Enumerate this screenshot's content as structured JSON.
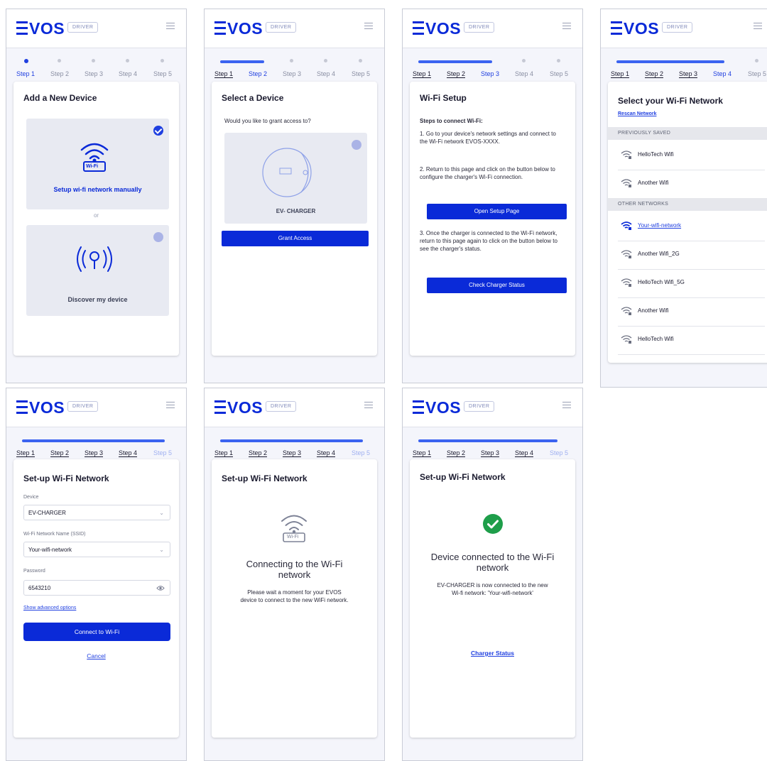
{
  "app": {
    "logo": "VOS",
    "badge": "DRIVER"
  },
  "steps": [
    "Step 1",
    "Step 2",
    "Step 3",
    "Step 4",
    "Step 5"
  ],
  "screen1": {
    "title": "Add a New Device",
    "option1": "Setup wi-fi network manually",
    "or": "or",
    "option2": "Discover my device",
    "wifi_badge": "Wi-Fi"
  },
  "screen2": {
    "title": "Select a Device",
    "question": "Would you like to grant access to?",
    "device_name": "EV- CHARGER",
    "button": "Grant Access"
  },
  "screen3": {
    "title": "Wi-Fi Setup",
    "subtitle": "Steps to connect Wi-Fi:",
    "step1": "1. Go to your device's network settings and connect to the Wi-Fi network EVOS-XXXX.",
    "step2": "2. Return to this page and click on the button below to configure the charger's Wi-Fi connection.",
    "button1": "Open Setup Page",
    "step3": "3. Once the charger is connected to the Wi-Fi network, return to this page again to click on the button below to see the charger's status.",
    "button2": "Check Charger Status"
  },
  "screen4": {
    "title": "Select your Wi-Fi Network",
    "rescan": "Rescan Network",
    "saved_header": "PREVIOUSLY SAVED",
    "saved": [
      "HelloTech Wifi",
      "Another Wifi"
    ],
    "other_header": "OTHER NETWORKS",
    "selected": "Your-wifi-network",
    "other": [
      "Another Wifi_2G",
      "HelloTech Wifi_5G",
      "Another Wifi",
      "HelloTech Wifi"
    ]
  },
  "screen5": {
    "title": "Set-up Wi-Fi Network",
    "device_label": "Device",
    "device_value": "EV-CHARGER",
    "ssid_label": "Wi-Fi Network Name (SSID)",
    "ssid_value": "Your-wifi-network",
    "password_label": "Password",
    "password_value": "6543210",
    "advanced": "Show advanced options",
    "button": "Connect to Wi-Fi",
    "cancel": "Cancel"
  },
  "screen6": {
    "title": "Set-up Wi-Fi Network",
    "heading": "Connecting to the Wi-Fi network",
    "message": "Please wait a moment for your EVOS device to connect to the new WiFi network.",
    "wifi_badge": "Wi-Fi"
  },
  "screen7": {
    "title": "Set-up Wi-Fi Network",
    "heading": "Device connected to the Wi-Fi network",
    "message": "EV-CHARGER is now connected to the new Wi-fi network: 'Your-wifi-network'",
    "link": "Charger Status"
  },
  "colors": {
    "brand": "#0a2ad8",
    "progress": "#3b63f0",
    "success": "#1e9e4a"
  }
}
